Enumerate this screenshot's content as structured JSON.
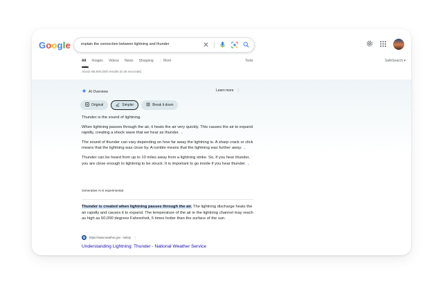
{
  "logo": {
    "letters": [
      "G",
      "o",
      "o",
      "g",
      "l",
      "e"
    ],
    "colors": [
      "#4285F4",
      "#EA4335",
      "#FBBC05",
      "#4285F4",
      "#34A853",
      "#EA4335"
    ]
  },
  "search": {
    "query": "explain the connection between lightning and thunder",
    "icons": [
      "close-icon",
      "mic-icon",
      "lens-icon",
      "search-icon"
    ]
  },
  "header": {
    "icons": [
      "settings-icon",
      "apps-grid-icon",
      "avatar"
    ]
  },
  "tabs": {
    "items": [
      "All",
      "Images",
      "Videos",
      "News",
      "Shopping",
      "⋮ More"
    ],
    "active": "All",
    "tools": "Tools",
    "safesearch": "SafeSearch ▾"
  },
  "stats": "About 88,600,000 results (0.46 seconds)",
  "ai_overview": {
    "title": "AI Overview",
    "learn_more": "Learn more",
    "menu": "⋮",
    "chips": [
      {
        "label": "Original",
        "icon": "document-icon"
      },
      {
        "label": "Simpler",
        "icon": "simplify-icon",
        "selected": true
      },
      {
        "label": "Break it down",
        "icon": "list-icon"
      }
    ],
    "paragraphs": [
      "Thunder is the sound of lightning.",
      "When lightning passes through the air, it heats the air very quickly. This causes the air to expand rapidly, creating a shock wave that we hear as thunder.",
      "The sound of thunder can vary depending on how far away the lightning is. A sharp crack or click means that the lightning was close by. A rumble means that the lightning was further away.",
      "Thunder can be heard from up to 10 miles away from a lightning strike. So, if you hear thunder, you are close enough to lightning to be struck. It is important to go inside if you hear thunder."
    ],
    "note": "Generative AI is experimental.",
    "quote_highlight": "Thunder is created when lightning passes through the air.",
    "quote_rest": " The lightning discharge heats the air rapidly and causes it to expand. The temperature of the air in the lightning channel may reach as high as 50,000 degrees Fahrenheit, 5 times hotter than the surface of the sun.",
    "source_url": "https://www.weather.gov › safety",
    "source_menu": "⋮",
    "source_title": "Understanding Lightning: Thunder - National Weather Service"
  }
}
